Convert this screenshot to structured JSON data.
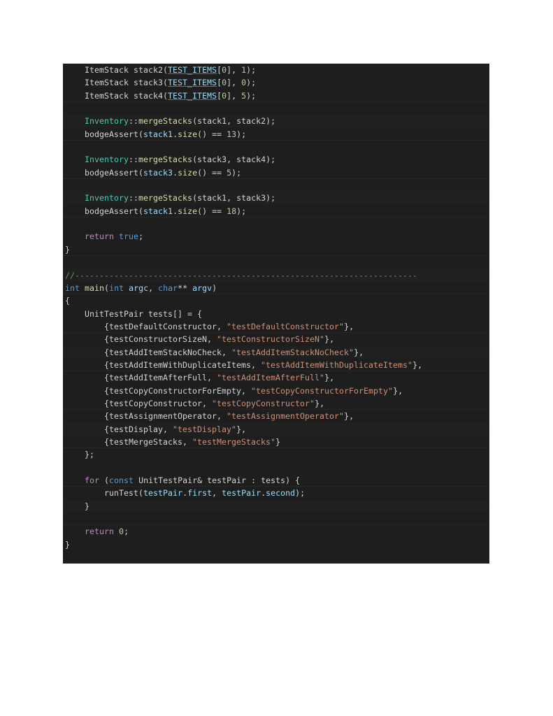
{
  "editor": {
    "language": "cpp",
    "theme": "dark-plus",
    "background": "#1e1e1e",
    "foreground": "#d4d4d4",
    "colors": {
      "type": "#4ec9b0",
      "keyword": "#569cd6",
      "control": "#c586c0",
      "function": "#dcdcaa",
      "variable": "#9cdcfe",
      "string": "#ce9178",
      "number": "#b5cea8",
      "comment": "#6a9955",
      "punctuation": "#d4d4d4"
    }
  },
  "code": {
    "lines": [
      [
        {
          "t": "    ",
          "c": "default"
        },
        {
          "t": "ItemStack",
          "c": "plainid"
        },
        {
          "t": " stack2(",
          "c": "punct"
        },
        {
          "t": "TEST_ITEMS",
          "c": "macro"
        },
        {
          "t": "[",
          "c": "punct"
        },
        {
          "t": "0",
          "c": "number"
        },
        {
          "t": "], ",
          "c": "punct"
        },
        {
          "t": "1",
          "c": "number"
        },
        {
          "t": ");",
          "c": "punct"
        }
      ],
      [
        {
          "t": "    ",
          "c": "default"
        },
        {
          "t": "ItemStack",
          "c": "plainid"
        },
        {
          "t": " stack3(",
          "c": "punct"
        },
        {
          "t": "TEST_ITEMS",
          "c": "macro"
        },
        {
          "t": "[",
          "c": "punct"
        },
        {
          "t": "0",
          "c": "number"
        },
        {
          "t": "], ",
          "c": "punct"
        },
        {
          "t": "0",
          "c": "number"
        },
        {
          "t": ");",
          "c": "punct"
        }
      ],
      [
        {
          "t": "    ",
          "c": "default"
        },
        {
          "t": "ItemStack",
          "c": "plainid"
        },
        {
          "t": " stack4(",
          "c": "punct"
        },
        {
          "t": "TEST_ITEMS",
          "c": "macro"
        },
        {
          "t": "[",
          "c": "punct"
        },
        {
          "t": "0",
          "c": "number"
        },
        {
          "t": "], ",
          "c": "punct"
        },
        {
          "t": "5",
          "c": "number"
        },
        {
          "t": ");",
          "c": "punct"
        }
      ],
      [],
      [
        {
          "t": "    ",
          "c": "default"
        },
        {
          "t": "Inventory",
          "c": "type"
        },
        {
          "t": "::",
          "c": "punct"
        },
        {
          "t": "mergeStacks",
          "c": "func"
        },
        {
          "t": "(stack1, stack2);",
          "c": "punct"
        }
      ],
      [
        {
          "t": "    ",
          "c": "default"
        },
        {
          "t": "bodgeAssert",
          "c": "plainid"
        },
        {
          "t": "(",
          "c": "punct"
        },
        {
          "t": "stack1",
          "c": "var"
        },
        {
          "t": ".",
          "c": "punct"
        },
        {
          "t": "size",
          "c": "func"
        },
        {
          "t": "() == ",
          "c": "punct"
        },
        {
          "t": "13",
          "c": "number"
        },
        {
          "t": ");",
          "c": "punct"
        }
      ],
      [],
      [
        {
          "t": "    ",
          "c": "default"
        },
        {
          "t": "Inventory",
          "c": "type"
        },
        {
          "t": "::",
          "c": "punct"
        },
        {
          "t": "mergeStacks",
          "c": "func"
        },
        {
          "t": "(stack3, stack4);",
          "c": "punct"
        }
      ],
      [
        {
          "t": "    ",
          "c": "default"
        },
        {
          "t": "bodgeAssert",
          "c": "plainid"
        },
        {
          "t": "(",
          "c": "punct"
        },
        {
          "t": "stack3",
          "c": "var"
        },
        {
          "t": ".",
          "c": "punct"
        },
        {
          "t": "size",
          "c": "func"
        },
        {
          "t": "() == ",
          "c": "punct"
        },
        {
          "t": "5",
          "c": "number"
        },
        {
          "t": ");",
          "c": "punct"
        }
      ],
      [],
      [
        {
          "t": "    ",
          "c": "default"
        },
        {
          "t": "Inventory",
          "c": "type"
        },
        {
          "t": "::",
          "c": "punct"
        },
        {
          "t": "mergeStacks",
          "c": "func"
        },
        {
          "t": "(stack1, stack3);",
          "c": "punct"
        }
      ],
      [
        {
          "t": "    ",
          "c": "default"
        },
        {
          "t": "bodgeAssert",
          "c": "plainid"
        },
        {
          "t": "(",
          "c": "punct"
        },
        {
          "t": "stack1",
          "c": "var"
        },
        {
          "t": ".",
          "c": "punct"
        },
        {
          "t": "size",
          "c": "func"
        },
        {
          "t": "() == ",
          "c": "punct"
        },
        {
          "t": "18",
          "c": "number"
        },
        {
          "t": ");",
          "c": "punct"
        }
      ],
      [],
      [
        {
          "t": "    ",
          "c": "default"
        },
        {
          "t": "return",
          "c": "control"
        },
        {
          "t": " ",
          "c": "punct"
        },
        {
          "t": "true",
          "c": "keyword"
        },
        {
          "t": ";",
          "c": "punct"
        }
      ],
      [
        {
          "t": "}",
          "c": "punct"
        }
      ],
      [],
      [
        {
          "t": "//----------------------------------------------------------------------",
          "c": "comment"
        }
      ],
      [
        {
          "t": "int",
          "c": "keyword"
        },
        {
          "t": " ",
          "c": "punct"
        },
        {
          "t": "main",
          "c": "func"
        },
        {
          "t": "(",
          "c": "punct"
        },
        {
          "t": "int",
          "c": "keyword"
        },
        {
          "t": " ",
          "c": "punct"
        },
        {
          "t": "argc",
          "c": "var"
        },
        {
          "t": ", ",
          "c": "punct"
        },
        {
          "t": "char",
          "c": "keyword"
        },
        {
          "t": "** ",
          "c": "punct"
        },
        {
          "t": "argv",
          "c": "var"
        },
        {
          "t": ")",
          "c": "punct"
        }
      ],
      [
        {
          "t": "{",
          "c": "punct"
        }
      ],
      [
        {
          "t": "    ",
          "c": "default"
        },
        {
          "t": "UnitTestPair",
          "c": "plainid"
        },
        {
          "t": " tests[] = {",
          "c": "punct"
        }
      ],
      [
        {
          "t": "        {",
          "c": "punct"
        },
        {
          "t": "testDefaultConstructor",
          "c": "plainid"
        },
        {
          "t": ", ",
          "c": "punct"
        },
        {
          "t": "\"testDefaultConstructor\"",
          "c": "string"
        },
        {
          "t": "},",
          "c": "punct"
        }
      ],
      [
        {
          "t": "        {",
          "c": "punct"
        },
        {
          "t": "testConstructorSizeN",
          "c": "plainid"
        },
        {
          "t": ", ",
          "c": "punct"
        },
        {
          "t": "\"testConstructorSizeN\"",
          "c": "string"
        },
        {
          "t": "},",
          "c": "punct"
        }
      ],
      [
        {
          "t": "        {",
          "c": "punct"
        },
        {
          "t": "testAddItemStackNoCheck",
          "c": "plainid"
        },
        {
          "t": ", ",
          "c": "punct"
        },
        {
          "t": "\"testAddItemStackNoCheck\"",
          "c": "string"
        },
        {
          "t": "},",
          "c": "punct"
        }
      ],
      [
        {
          "t": "        {",
          "c": "punct"
        },
        {
          "t": "testAddItemWithDuplicateItems",
          "c": "plainid"
        },
        {
          "t": ", ",
          "c": "punct"
        },
        {
          "t": "\"testAddItemWithDuplicateItems\"",
          "c": "string"
        },
        {
          "t": "},",
          "c": "punct"
        }
      ],
      [
        {
          "t": "        {",
          "c": "punct"
        },
        {
          "t": "testAddItemAfterFull",
          "c": "plainid"
        },
        {
          "t": ", ",
          "c": "punct"
        },
        {
          "t": "\"testAddItemAfterFull\"",
          "c": "string"
        },
        {
          "t": "},",
          "c": "punct"
        }
      ],
      [
        {
          "t": "        {",
          "c": "punct"
        },
        {
          "t": "testCopyConstructorForEmpty",
          "c": "plainid"
        },
        {
          "t": ", ",
          "c": "punct"
        },
        {
          "t": "\"testCopyConstructorForEmpty\"",
          "c": "string"
        },
        {
          "t": "},",
          "c": "punct"
        }
      ],
      [
        {
          "t": "        {",
          "c": "punct"
        },
        {
          "t": "testCopyConstructor",
          "c": "plainid"
        },
        {
          "t": ", ",
          "c": "punct"
        },
        {
          "t": "\"testCopyConstructor\"",
          "c": "string"
        },
        {
          "t": "},",
          "c": "punct"
        }
      ],
      [
        {
          "t": "        {",
          "c": "punct"
        },
        {
          "t": "testAssignmentOperator",
          "c": "plainid"
        },
        {
          "t": ", ",
          "c": "punct"
        },
        {
          "t": "\"testAssignmentOperator\"",
          "c": "string"
        },
        {
          "t": "},",
          "c": "punct"
        }
      ],
      [
        {
          "t": "        {",
          "c": "punct"
        },
        {
          "t": "testDisplay",
          "c": "plainid"
        },
        {
          "t": ", ",
          "c": "punct"
        },
        {
          "t": "\"testDisplay\"",
          "c": "string"
        },
        {
          "t": "},",
          "c": "punct"
        }
      ],
      [
        {
          "t": "        {",
          "c": "punct"
        },
        {
          "t": "testMergeStacks",
          "c": "plainid"
        },
        {
          "t": ", ",
          "c": "punct"
        },
        {
          "t": "\"testMergeStacks\"",
          "c": "string"
        },
        {
          "t": "}",
          "c": "punct"
        }
      ],
      [
        {
          "t": "    };",
          "c": "punct"
        }
      ],
      [],
      [
        {
          "t": "    ",
          "c": "default"
        },
        {
          "t": "for",
          "c": "control"
        },
        {
          "t": " (",
          "c": "punct"
        },
        {
          "t": "const",
          "c": "keyword"
        },
        {
          "t": " ",
          "c": "punct"
        },
        {
          "t": "UnitTestPair",
          "c": "plainid"
        },
        {
          "t": "& testPair : tests) {",
          "c": "punct"
        }
      ],
      [
        {
          "t": "        ",
          "c": "default"
        },
        {
          "t": "runTest",
          "c": "plainid"
        },
        {
          "t": "(",
          "c": "punct"
        },
        {
          "t": "testPair",
          "c": "var"
        },
        {
          "t": ".",
          "c": "punct"
        },
        {
          "t": "first",
          "c": "var"
        },
        {
          "t": ", ",
          "c": "punct"
        },
        {
          "t": "testPair",
          "c": "var"
        },
        {
          "t": ".",
          "c": "punct"
        },
        {
          "t": "second",
          "c": "var"
        },
        {
          "t": ");",
          "c": "punct"
        }
      ],
      [
        {
          "t": "    }",
          "c": "punct"
        }
      ],
      [],
      [
        {
          "t": "    ",
          "c": "default"
        },
        {
          "t": "return",
          "c": "control"
        },
        {
          "t": " ",
          "c": "punct"
        },
        {
          "t": "0",
          "c": "number"
        },
        {
          "t": ";",
          "c": "punct"
        }
      ],
      [
        {
          "t": "}",
          "c": "punct"
        }
      ],
      []
    ]
  }
}
